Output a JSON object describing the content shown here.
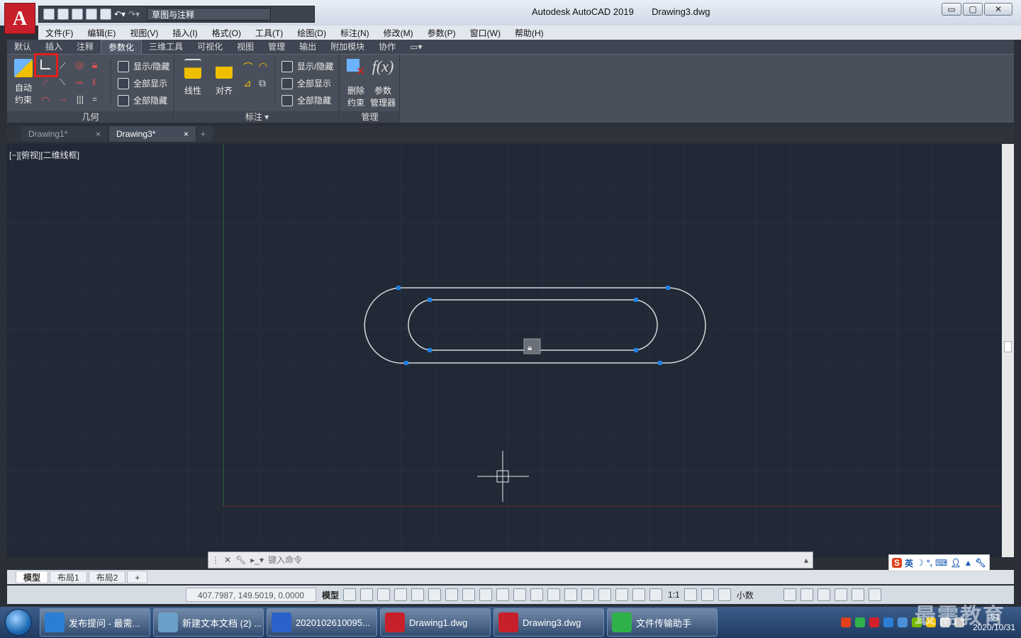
{
  "titlebar": {
    "workspace": "草图与注释",
    "app_title": "Autodesk AutoCAD 2019",
    "doc_title": "Drawing3.dwg",
    "min": "▭",
    "max": "▢",
    "close": "✕"
  },
  "menu": [
    "文件(F)",
    "编辑(E)",
    "视图(V)",
    "插入(I)",
    "格式(O)",
    "工具(T)",
    "绘图(D)",
    "标注(N)",
    "修改(M)",
    "参数(P)",
    "窗口(W)",
    "帮助(H)"
  ],
  "ribbon_tabs": [
    "默认",
    "插入",
    "注释",
    "参数化",
    "三维工具",
    "可视化",
    "视图",
    "管理",
    "输出",
    "附加模块",
    "协作"
  ],
  "ribbon_active_tab": "参数化",
  "geometry_panel": {
    "title": "几何",
    "auto_line1": "自动",
    "auto_line2": "约束",
    "show_hide": "显示/隐藏",
    "show_all": "全部显示",
    "hide_all": "全部隐藏"
  },
  "dimension_panel": {
    "title": "标注",
    "linear": "线性",
    "aligned": "对齐",
    "show_hide": "显示/隐藏",
    "show_all": "全部显示",
    "hide_all": "全部隐藏"
  },
  "manage_panel": {
    "title": "管理",
    "delete_line1": "删除",
    "delete_line2": "约束",
    "params_line1": "参数",
    "params_line2": "管理器",
    "fx": "f(x)"
  },
  "doc_tabs": [
    {
      "label": "Drawing1*"
    },
    {
      "label": "Drawing3*"
    }
  ],
  "doc_tab_close": "×",
  "doc_tab_add": "+",
  "viewport_label": "[−][俯视][二维线框]",
  "command": {
    "placeholder": "键入命令"
  },
  "layout_tabs": [
    "模型",
    "布局1",
    "布局2"
  ],
  "layout_add": "+",
  "status": {
    "coords": "407.7987, 149.5019, 0.0000",
    "model": "模型",
    "scale": "1:1",
    "units": "小数"
  },
  "ime": {
    "mode": "英"
  },
  "taskbar": [
    {
      "label": "发布提问 - 最需...",
      "color": "#2a7fd4"
    },
    {
      "label": "新建文本文档 (2) ...",
      "color": "#6aa0c8"
    },
    {
      "label": "2020102610095...",
      "color": "#2b62c9"
    },
    {
      "label": "Drawing1.dwg",
      "color": "#c8202a"
    },
    {
      "label": "Drawing3.dwg",
      "color": "#c8202a"
    },
    {
      "label": "文件传输助手",
      "color": "#2fb14a"
    }
  ],
  "clock": {
    "time": ":51",
    "date": "2020/10/31"
  },
  "watermark": "最需教育",
  "colors": {
    "canvas": "#212836",
    "grid": "#2b3342",
    "accent_red": "#e0201c",
    "grip": "#1f7fe0"
  }
}
